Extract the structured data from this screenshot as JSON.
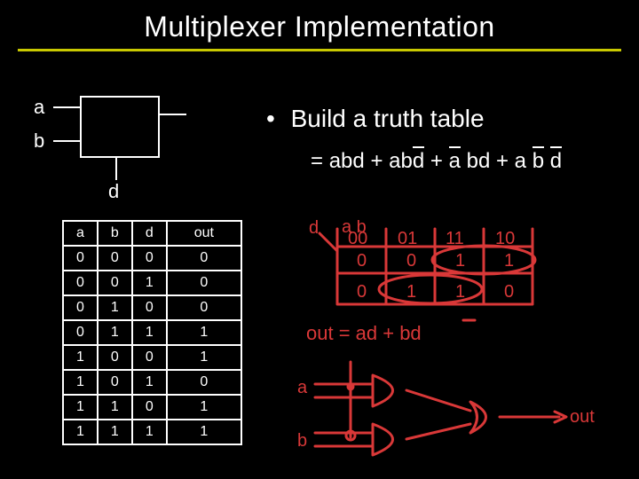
{
  "title": "Multiplexer Implementation",
  "diagram": {
    "a": "a",
    "b": "b",
    "d": "d"
  },
  "bullet": {
    "text": "Build a truth table"
  },
  "equation": {
    "eq": "=",
    "plus": "+",
    "t1_a": "a",
    "t1_b": "b",
    "t1_d": "d",
    "t2_a": "a",
    "t2_b": "b",
    "t2_d": "d",
    "t3_a": "a",
    "t3_b": "b",
    "t3_d": "d",
    "t4_a": "a",
    "t4_b": "b",
    "t4_d": "d"
  },
  "truth_table": {
    "headers": [
      "a",
      "b",
      "d",
      "out"
    ],
    "rows": [
      [
        "0",
        "0",
        "0",
        "0"
      ],
      [
        "0",
        "0",
        "1",
        "0"
      ],
      [
        "0",
        "1",
        "0",
        "0"
      ],
      [
        "0",
        "1",
        "1",
        "1"
      ],
      [
        "1",
        "0",
        "0",
        "1"
      ],
      [
        "1",
        "0",
        "1",
        "0"
      ],
      [
        "1",
        "1",
        "0",
        "1"
      ],
      [
        "1",
        "1",
        "1",
        "1"
      ]
    ]
  },
  "sketch": {
    "kmap_col_labels": [
      "00",
      "01",
      "11",
      "10"
    ],
    "kmap_row_var": "d",
    "kmap_col_vars": "a b",
    "kmap_cells_row0": [
      "0",
      "0",
      "1",
      "1"
    ],
    "kmap_cells_row1": [
      "0",
      "1",
      "1",
      "0"
    ],
    "out_expr": "out = ad + bd",
    "gate_in_a": "a",
    "gate_in_b": "b",
    "gate_out": "out"
  }
}
